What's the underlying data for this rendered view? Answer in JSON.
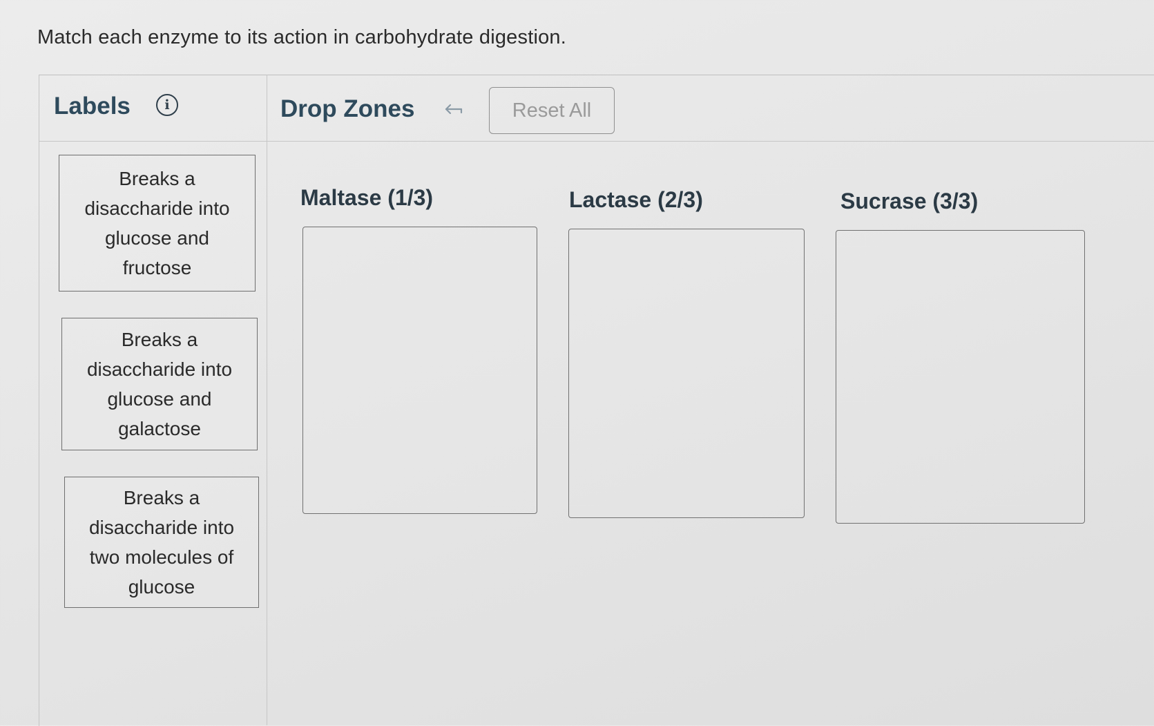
{
  "question": "Match each enzyme to its action in carbohydrate digestion.",
  "labels_panel": {
    "title": "Labels",
    "info_icon": "info-icon",
    "items": [
      {
        "text": "Breaks a disaccharide into glucose and fructose"
      },
      {
        "text": "Breaks a disaccharide into glucose and galactose"
      },
      {
        "text": "Breaks a disaccharide into two molecules of glucose"
      }
    ]
  },
  "drop_zones_panel": {
    "title": "Drop Zones",
    "undo_icon": "undo-arrow-icon",
    "reset_label": "Reset All",
    "zones": [
      {
        "title": "Maltase (1/3)"
      },
      {
        "title": "Lactase (2/3)"
      },
      {
        "title": "Sucrase (3/3)"
      }
    ]
  }
}
